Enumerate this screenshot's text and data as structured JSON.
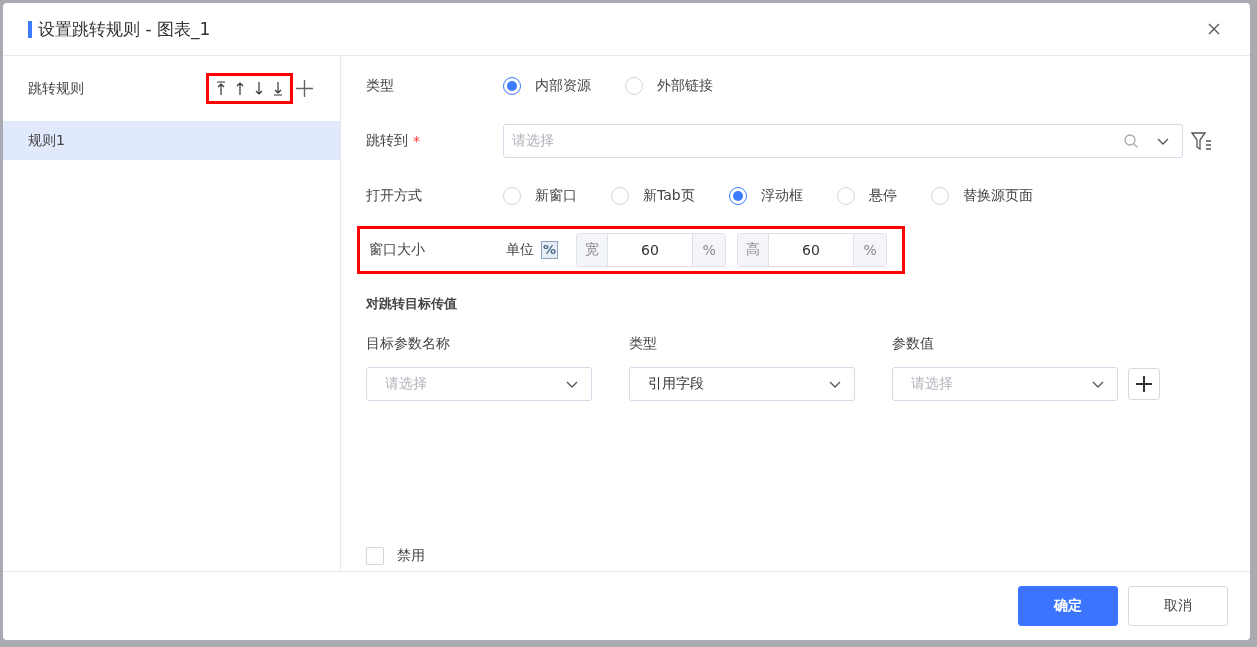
{
  "dialog": {
    "title": "设置跳转规则 - 图表_1"
  },
  "sidebar": {
    "title": "跳转规则",
    "toolbar_highlighted": true,
    "tools": [
      {
        "kind": "top"
      },
      {
        "kind": "up"
      },
      {
        "kind": "down"
      },
      {
        "kind": "bottom"
      }
    ],
    "items": [
      {
        "label": "规则1",
        "selected": true
      }
    ]
  },
  "form": {
    "type_row": {
      "label": "类型",
      "options": [
        {
          "label": "内部资源",
          "selected": true
        },
        {
          "label": "外部链接",
          "selected": false
        }
      ]
    },
    "target_row": {
      "label": "跳转到",
      "required_mark": "*",
      "placeholder": "请选择"
    },
    "open_row": {
      "label": "打开方式",
      "options": [
        {
          "label": "新窗口",
          "selected": false
        },
        {
          "label": "新Tab页",
          "selected": false
        },
        {
          "label": "浮动框",
          "selected": true
        },
        {
          "label": "悬停",
          "selected": false
        },
        {
          "label": "替换源页面",
          "selected": false
        }
      ]
    },
    "size_row": {
      "label": "窗口大小",
      "highlighted": true,
      "unit_label": "单位",
      "unit_toggle": "%",
      "fields": [
        {
          "prefix": "宽",
          "value": "60",
          "suffix": "%"
        },
        {
          "prefix": "高",
          "value": "60",
          "suffix": "%"
        }
      ]
    },
    "params": {
      "title": "对跳转目标传值",
      "columns": [
        {
          "label": "目标参数名称",
          "placeholder": "请选择"
        },
        {
          "label": "类型",
          "value": "引用字段"
        },
        {
          "label": "参数值",
          "placeholder": "请选择"
        }
      ]
    },
    "disable": {
      "label": "禁用",
      "checked": false
    }
  },
  "buttons": [
    {
      "label": "确定",
      "kind": "primary"
    },
    {
      "label": "取消",
      "kind": "default"
    }
  ]
}
